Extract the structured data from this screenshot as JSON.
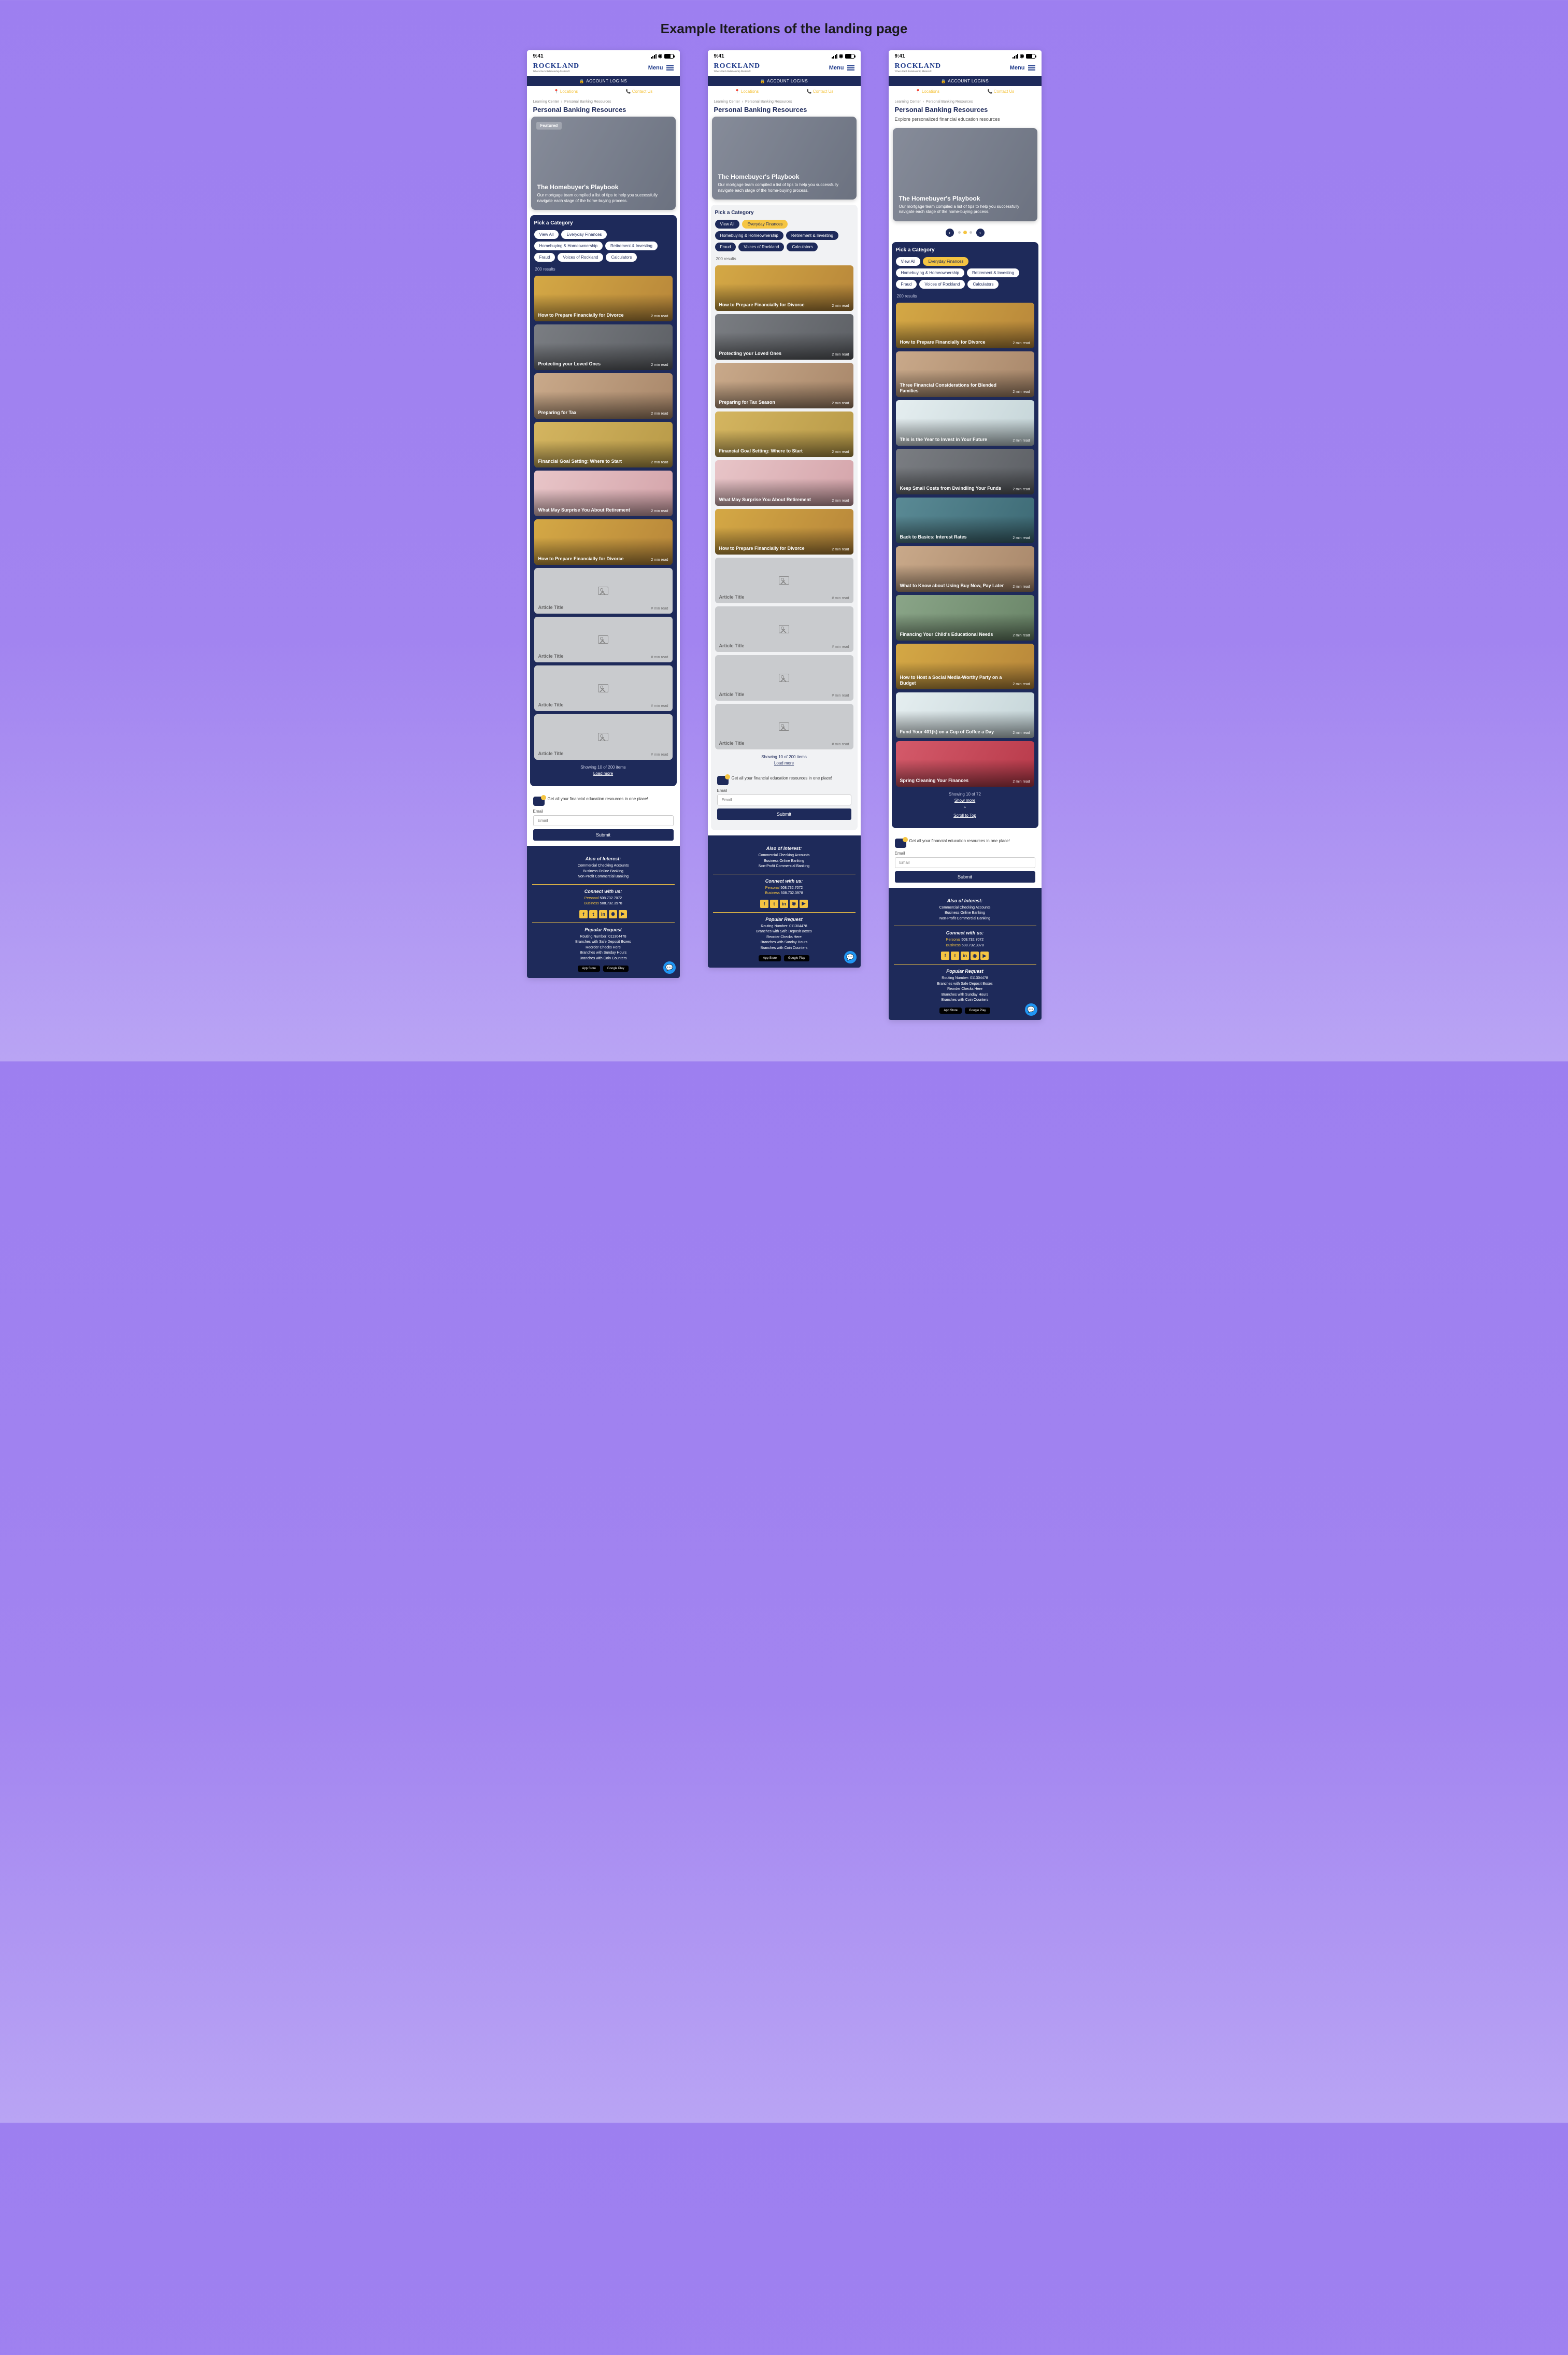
{
  "page_heading": "Example Iterations of the landing page",
  "status": {
    "time": "9:41"
  },
  "brand": {
    "name": "ROCKLAND",
    "tag": "Where Each Relationship Matters®",
    "menu": "Menu"
  },
  "login_bar": "ACCOUNT LOGINS",
  "util": {
    "locations": "Locations",
    "contact": "Contact Us"
  },
  "crumb": {
    "a": "Learning Center",
    "b": "Personal Banking Resources"
  },
  "h1": "Personal Banking Resources",
  "sub": "Explore personalized financial education resources",
  "hero": {
    "featured": "Featured",
    "title": "The Homebuyer's Playbook",
    "desc_long": "Our mortgage team compiled a list of tips to help you successfully navigate each stage of the home-buying process.",
    "desc_short": "Our mortgage team compiled a list of tips to help you successfully navigate each stage of the home-buying process."
  },
  "cat_title": "Pick a Category",
  "chips": {
    "view_all": "View All",
    "everyday": "Everyday Finances",
    "home": "Homebuying & Homeownership",
    "retire": "Retirement & Investing",
    "fraud": "Fraud",
    "voices": "Voices of Rockland",
    "calc": "Calculators"
  },
  "results": "200 results",
  "read2": "2 min read",
  "read_n": "# min read",
  "ph_title": "Article Title",
  "v1_cards": [
    "How to Prepare Financially for Divorce",
    "Protecting your Loved Ones",
    "Preparing for Tax",
    "Financial Goal Setting: Where to Start",
    "What May Surprise You About Retirement",
    "How to Prepare Financially for Divorce"
  ],
  "v2_cards": [
    "How to Prepare Financially for Divorce",
    "Protecting your Loved Ones",
    "Preparing for Tax Season",
    "Financial Goal Setting: Where to Start",
    "What May Surprise You About Retirement",
    "How to Prepare Financially for Divorce"
  ],
  "v3_cards": [
    "How to Prepare Financially for Divorce",
    "Three Financial Considerations for Blended Families",
    "This is the Year to Invest in Your Future",
    "Keep Small Costs from Dwindling Your Funds",
    "Back to Basics: Interest Rates",
    "What to Know about Using Buy Now, Pay Later",
    "Financing Your Child's Educational Needs",
    "How to Host a Social Media-Worthy Party on a Budget",
    "Fund Your 401(k) on a Cup of Coffee a Day",
    "Spring Cleaning Your Finances"
  ],
  "pager": {
    "v1": "Showing 10 of 200 items",
    "v2": "Showing 10 of 200 items",
    "v3": "Showing 10 of 72",
    "load": "Load more",
    "show": "Show more",
    "scroll": "Scroll to Top"
  },
  "email": {
    "promo": "Get all your financial education resources in one place!",
    "label": "Email",
    "ph": "Email",
    "submit": "Submit"
  },
  "footer": {
    "also": "Also of Interest:",
    "l1": "Commercial Checking Accounts",
    "l2": "Business Online Banking",
    "l3": "Non-Profit Commercial Banking",
    "connect": "Connect with us:",
    "pers": "Personal",
    "biz": "Business",
    "ph1": "508.732.7072",
    "ph2": "508.732.3978",
    "pop": "Popular Request",
    "r1": "Routing Number: 011304478",
    "r2": "Branches with Safe Deposit Boxes",
    "r3": "Reorder Checks Here",
    "r4": "Branches with Sunday Hours",
    "r5": "Branches with Coin Counters",
    "app": "App Store",
    "play": "Google Play"
  }
}
